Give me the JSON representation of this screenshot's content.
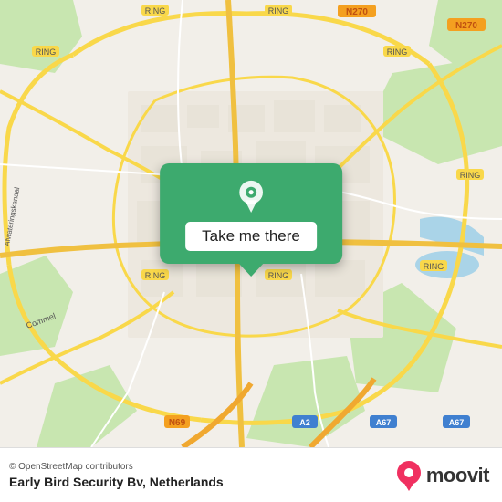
{
  "map": {
    "title": "Early Bird Security Bv location map",
    "center_lat": 51.6978,
    "center_lon": 5.3037
  },
  "popup": {
    "button_label": "Take me there"
  },
  "footer": {
    "osm_credit": "© OpenStreetMap contributors",
    "location_name": "Early Bird Security Bv, Netherlands"
  },
  "moovit": {
    "logo_text": "moovit"
  },
  "road_labels": {
    "ring": "RING",
    "n270": "N270",
    "a2": "A2",
    "a67": "A67",
    "n69": "N69",
    "commel": "Commel"
  }
}
